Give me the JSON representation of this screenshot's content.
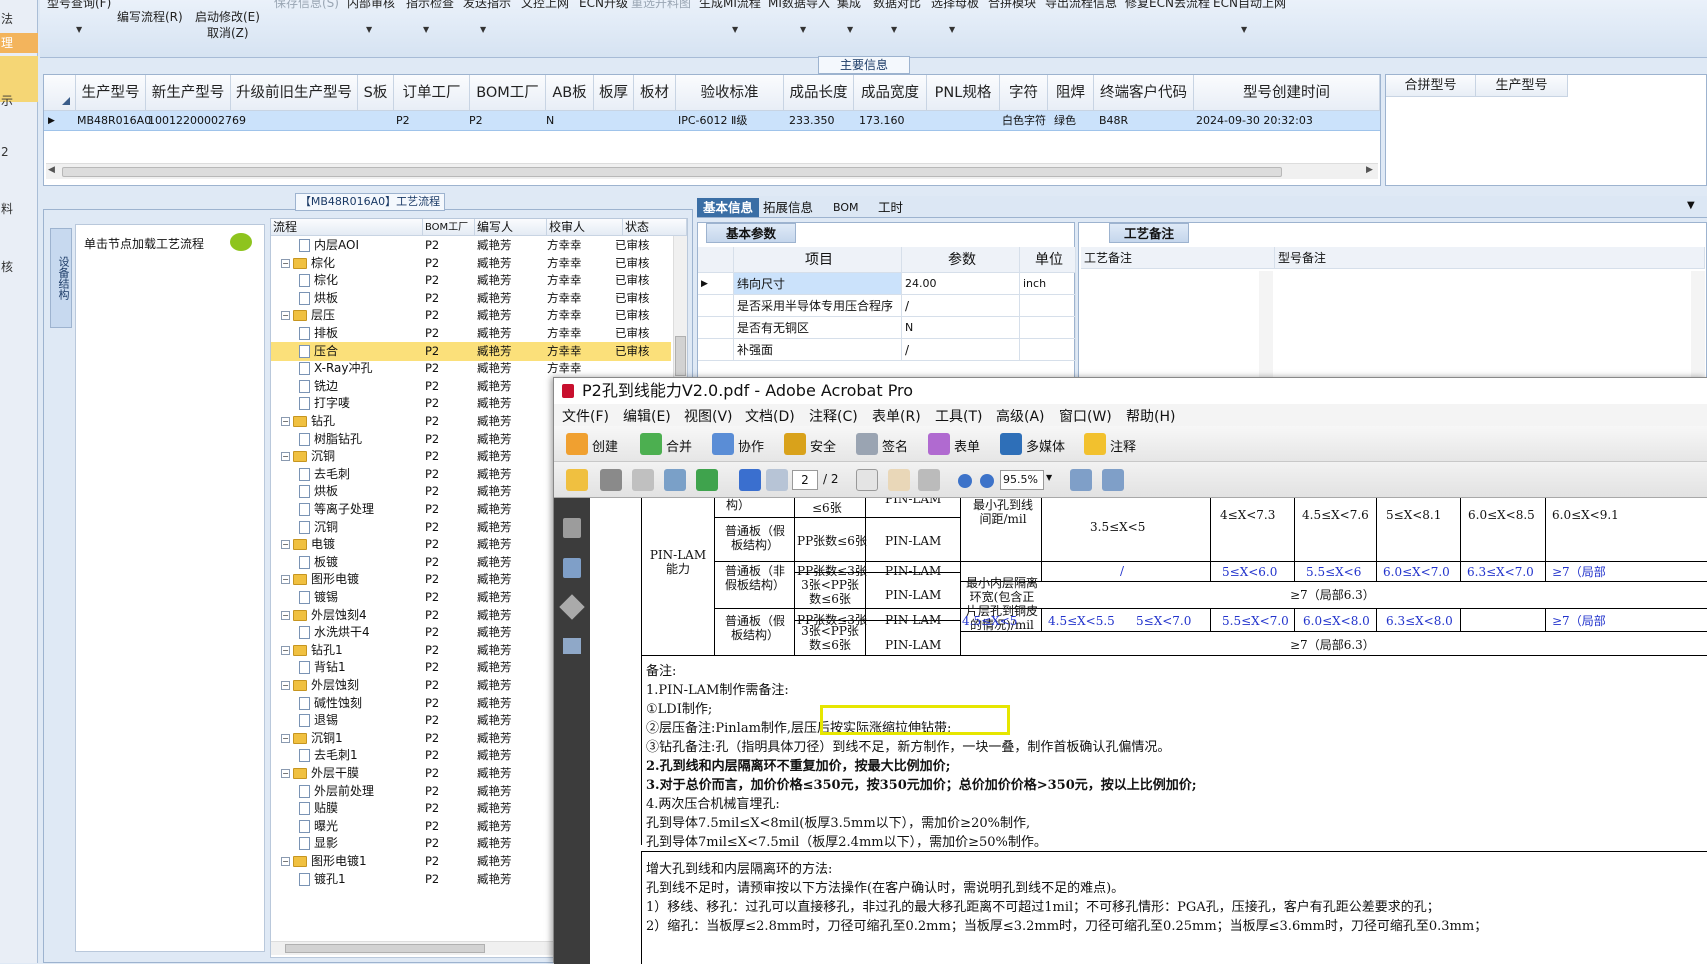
{
  "sidebar": {
    "items": [
      "法",
      "理",
      "示",
      "2",
      "料",
      "核"
    ]
  },
  "toolbar": {
    "items": [
      "型号查询(F)",
      "编写流程(R)",
      "启动修改(E)",
      "取消(Z)",
      "保存信息(S)",
      "内部审核",
      "指示检查",
      "发送指示",
      "文控上网",
      "ECN升级",
      "重选开料图",
      "生成MI流程",
      "MI数据导入",
      "集成",
      "数据对比",
      "选择母板",
      "合拼模块",
      "导出流程信息",
      "修复ECN丢流程",
      "ECN自动上网"
    ]
  },
  "main_info": {
    "title": "主要信息",
    "headers": [
      "生产型号",
      "新生产型号",
      "升级前旧生产型号",
      "S板",
      "订单工厂",
      "BOM工厂",
      "AB板",
      "板厚",
      "板材",
      "验收标准",
      "成品长度",
      "成品宽度",
      "PNL规格",
      "字符",
      "阻焊",
      "终端客户代码",
      "型号创建时间"
    ],
    "row": [
      "MB48R016A0",
      "10012200002769",
      "",
      "",
      "P2",
      "P2",
      "N",
      "",
      "",
      "IPC-6012 Ⅱ级",
      "233.350",
      "173.160",
      "",
      "白色字符",
      "绿色",
      "B48R",
      "2024-09-30 20:32:03"
    ],
    "right_headers": [
      "合拼型号",
      "生产型号"
    ]
  },
  "workflow": {
    "title": "【MB48R016A0】工艺流程",
    "side_tab": "设备结构",
    "note": "单击节点加载工艺流程",
    "columns": [
      "流程",
      "BOM工厂",
      "编写人",
      "校审人",
      "状态"
    ],
    "rows": [
      {
        "name": "内层AOI",
        "level": 2,
        "bom": "P2",
        "writer": "臧艳芳",
        "reviewer": "方幸幸",
        "status": "已审核"
      },
      {
        "name": "棕化",
        "level": 1,
        "bom": "P2",
        "writer": "臧艳芳",
        "reviewer": "方幸幸",
        "status": "已审核"
      },
      {
        "name": "棕化",
        "level": 2,
        "bom": "P2",
        "writer": "臧艳芳",
        "reviewer": "方幸幸",
        "status": "已审核"
      },
      {
        "name": "烘板",
        "level": 2,
        "bom": "P2",
        "writer": "臧艳芳",
        "reviewer": "方幸幸",
        "status": "已审核"
      },
      {
        "name": "层压",
        "level": 1,
        "bom": "P2",
        "writer": "臧艳芳",
        "reviewer": "方幸幸",
        "status": "已审核"
      },
      {
        "name": "排板",
        "level": 2,
        "bom": "P2",
        "writer": "臧艳芳",
        "reviewer": "方幸幸",
        "status": "已审核"
      },
      {
        "name": "压合",
        "level": 2,
        "bom": "P2",
        "writer": "臧艳芳",
        "reviewer": "方幸幸",
        "status": "已审核",
        "selected": true
      },
      {
        "name": "X-Ray冲孔",
        "level": 2,
        "bom": "P2",
        "writer": "臧艳芳",
        "reviewer": "方幸幸",
        "status": ""
      },
      {
        "name": "铣边",
        "level": 2,
        "bom": "P2",
        "writer": "臧艳芳",
        "reviewer": "",
        "status": ""
      },
      {
        "name": "打字唛",
        "level": 2,
        "bom": "P2",
        "writer": "臧艳芳",
        "reviewer": "",
        "status": ""
      },
      {
        "name": "钻孔",
        "level": 1,
        "bom": "P2",
        "writer": "臧艳芳",
        "reviewer": "",
        "status": ""
      },
      {
        "name": "树脂钻孔",
        "level": 2,
        "bom": "P2",
        "writer": "臧艳芳",
        "reviewer": "",
        "status": ""
      },
      {
        "name": "沉铜",
        "level": 1,
        "bom": "P2",
        "writer": "臧艳芳",
        "reviewer": "",
        "status": ""
      },
      {
        "name": "去毛刺",
        "level": 2,
        "bom": "P2",
        "writer": "臧艳芳",
        "reviewer": "",
        "status": ""
      },
      {
        "name": "烘板",
        "level": 2,
        "bom": "P2",
        "writer": "臧艳芳",
        "reviewer": "",
        "status": ""
      },
      {
        "name": "等离子处理",
        "level": 2,
        "bom": "P2",
        "writer": "臧艳芳",
        "reviewer": "",
        "status": ""
      },
      {
        "name": "沉铜",
        "level": 2,
        "bom": "P2",
        "writer": "臧艳芳",
        "reviewer": "",
        "status": ""
      },
      {
        "name": "电镀",
        "level": 1,
        "bom": "P2",
        "writer": "臧艳芳",
        "reviewer": "",
        "status": ""
      },
      {
        "name": "板镀",
        "level": 2,
        "bom": "P2",
        "writer": "臧艳芳",
        "reviewer": "",
        "status": ""
      },
      {
        "name": "图形电镀",
        "level": 1,
        "bom": "P2",
        "writer": "臧艳芳",
        "reviewer": "",
        "status": ""
      },
      {
        "name": "镀锡",
        "level": 2,
        "bom": "P2",
        "writer": "臧艳芳",
        "reviewer": "",
        "status": ""
      },
      {
        "name": "外层蚀刻4",
        "level": 1,
        "bom": "P2",
        "writer": "臧艳芳",
        "reviewer": "",
        "status": ""
      },
      {
        "name": "水洗烘干4",
        "level": 2,
        "bom": "P2",
        "writer": "臧艳芳",
        "reviewer": "",
        "status": ""
      },
      {
        "name": "钻孔1",
        "level": 1,
        "bom": "P2",
        "writer": "臧艳芳",
        "reviewer": "",
        "status": ""
      },
      {
        "name": "背钻1",
        "level": 2,
        "bom": "P2",
        "writer": "臧艳芳",
        "reviewer": "",
        "status": ""
      },
      {
        "name": "外层蚀刻",
        "level": 1,
        "bom": "P2",
        "writer": "臧艳芳",
        "reviewer": "",
        "status": ""
      },
      {
        "name": "碱性蚀刻",
        "level": 2,
        "bom": "P2",
        "writer": "臧艳芳",
        "reviewer": "",
        "status": ""
      },
      {
        "name": "退锡",
        "level": 2,
        "bom": "P2",
        "writer": "臧艳芳",
        "reviewer": "",
        "status": ""
      },
      {
        "name": "沉铜1",
        "level": 1,
        "bom": "P2",
        "writer": "臧艳芳",
        "reviewer": "",
        "status": ""
      },
      {
        "name": "去毛刺1",
        "level": 2,
        "bom": "P2",
        "writer": "臧艳芳",
        "reviewer": "",
        "status": ""
      },
      {
        "name": "外层干膜",
        "level": 1,
        "bom": "P2",
        "writer": "臧艳芳",
        "reviewer": "",
        "status": ""
      },
      {
        "name": "外层前处理",
        "level": 2,
        "bom": "P2",
        "writer": "臧艳芳",
        "reviewer": "",
        "status": ""
      },
      {
        "name": "贴膜",
        "level": 2,
        "bom": "P2",
        "writer": "臧艳芳",
        "reviewer": "",
        "status": ""
      },
      {
        "name": "曝光",
        "level": 2,
        "bom": "P2",
        "writer": "臧艳芳",
        "reviewer": "",
        "status": ""
      },
      {
        "name": "显影",
        "level": 2,
        "bom": "P2",
        "writer": "臧艳芳",
        "reviewer": "",
        "status": ""
      },
      {
        "name": "图形电镀1",
        "level": 1,
        "bom": "P2",
        "writer": "臧艳芳",
        "reviewer": "",
        "status": ""
      },
      {
        "name": "镀孔1",
        "level": 2,
        "bom": "P2",
        "writer": "臧艳芳",
        "reviewer": "",
        "status": ""
      }
    ]
  },
  "right_panel": {
    "tabs": [
      "基本信息",
      "拓展信息",
      "BOM",
      "工时"
    ],
    "params_tab": "基本参数",
    "params_headers": [
      "项目",
      "参数",
      "单位"
    ],
    "params": [
      {
        "item": "纬向尺寸",
        "value": "24.00",
        "unit": "inch"
      },
      {
        "item": "是否采用半导体专用压合程序",
        "value": "/",
        "unit": ""
      },
      {
        "item": "是否有无铜区",
        "value": "N",
        "unit": ""
      },
      {
        "item": "补强面",
        "value": "/",
        "unit": ""
      }
    ],
    "notes_tab": "工艺备注",
    "notes_headers": [
      "工艺备注",
      "型号备注"
    ]
  },
  "acrobat": {
    "title": "P2孔到线能力V2.0.pdf - Adobe Acrobat Pro",
    "menu": [
      "文件(F)",
      "编辑(E)",
      "视图(V)",
      "文档(D)",
      "注释(C)",
      "表单(R)",
      "工具(T)",
      "高级(A)",
      "窗口(W)",
      "帮助(H)"
    ],
    "toolbar1": [
      "创建",
      "合并",
      "协作",
      "安全",
      "签名",
      "表单",
      "多媒体",
      "注释"
    ],
    "page_current": "2",
    "page_total": "/ 2",
    "zoom": "95.5%",
    "table": {
      "row_label": "PIN-LAM能力",
      "c_board1": "普通板（假板结构）",
      "c_board2": "普通板（非假板结构）",
      "c_board3": "普通板（假板结构）",
      "pp1": "PP张数≤6张",
      "pp2": "PP张数≤3张",
      "pp3": "3张<PP张数≤6张",
      "pp4": "PP张数≤3张",
      "pp5": "3张<PP张数≤6张",
      "top_frag1": "构）",
      "top_frag2": "≤6张",
      "top_frag3": "PIN-LAM",
      "pinlam": "PIN-LAM",
      "m1": "最小孔到线间距/mil",
      "m2": "最小内层隔离环宽(包含正片层孔到铜皮的情况)/mil",
      "r1": [
        "3.5≤X<5",
        "4≤X<7.3",
        "4.5≤X<7.6",
        "5≤X<8.1",
        "6.0≤X<8.5",
        "6.0≤X<9.1"
      ],
      "r2": [
        "/",
        "5≤X<6.0",
        "5.5≤X<6",
        "6.0≤X<7.0",
        "6.3≤X<7.0",
        "≥7（局部"
      ],
      "r3": "≥7（局部6.3）",
      "r4": [
        "4.5≤X<5",
        "4.5≤X<5.5",
        "5≤X<7.0",
        "5.5≤X<7.0",
        "6.0≤X<8.0",
        "6.3≤X<8.0",
        "≥7（局部"
      ],
      "r5": "≥7（局部6.3）"
    },
    "notes": [
      "备注:",
      "1.PIN-LAM制作需备注:",
      "①LDI制作;",
      "②层压备注:Pinlam制作,层压后按实际涨缩拉伸钻带;",
      "③钻孔备注:孔（指明具体刀径）到线不足，新方制作，一块一叠，制作首板确认孔偏情况。",
      "2.孔到线和内层隔离环不重复加价，按最大比例加价;",
      "3.对于总价而言，加价价格≤350元，按350元加价；总价加价价格>350元，按以上比例加价;",
      "4.两次压合机械盲埋孔:",
      "孔到导体7.5mil≤X<8mil(板厚3.5mm以下），需加价≥20%制作,",
      "孔到导体7mil≤X<7.5mil（板厚2.4mm以下），需加价≥50%制作。"
    ],
    "notes2": [
      "增大孔到线和内层隔离环的方法:",
      "孔到线不足时，请预审按以下方法操作(在客户确认时，需说明孔到线不足的难点)。",
      "1）移线、移孔：过孔可以直接移孔，非过孔的最大移孔距离不可超过1mil；不可移孔情形：PGA孔，压接孔，客户有孔距公差要求的孔；",
      "2）缩孔：当板厚≤2.8mm时，刀径可缩孔至0.2mm；当板厚≤3.2mm时，刀径可缩孔至0.25mm；当板厚≤3.6mm时，刀径可缩孔至0.3mm；"
    ]
  }
}
